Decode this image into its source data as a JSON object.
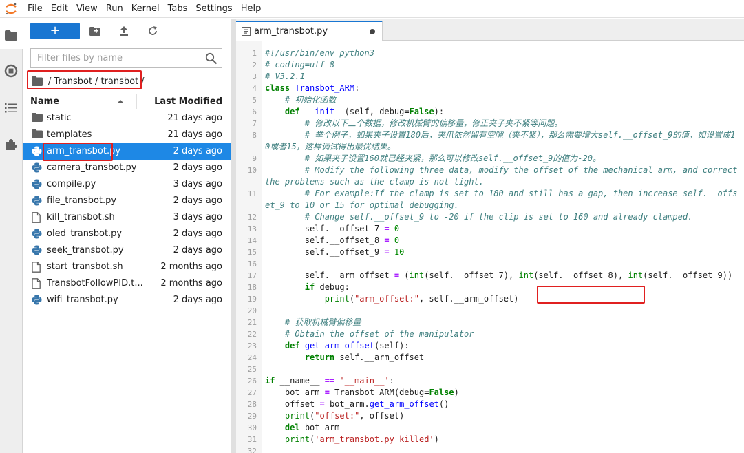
{
  "menubar": {
    "items": [
      "File",
      "Edit",
      "View",
      "Run",
      "Kernel",
      "Tabs",
      "Settings",
      "Help"
    ]
  },
  "toolbar": {
    "new_label": "+"
  },
  "filter": {
    "placeholder": "Filter files by name"
  },
  "breadcrumbs": {
    "root": "/",
    "parts": [
      "Transbot",
      "transbot"
    ],
    "trailing": "/"
  },
  "listing": {
    "header_name": "Name",
    "header_modified": "Last Modified",
    "files": [
      {
        "name": "static",
        "modified": "21 days ago",
        "icon": "folder-icon"
      },
      {
        "name": "templates",
        "modified": "21 days ago",
        "icon": "folder-icon"
      },
      {
        "name": "arm_transbot.py",
        "modified": "2 days ago",
        "icon": "python-icon",
        "selected": true
      },
      {
        "name": "camera_transbot.py",
        "modified": "2 days ago",
        "icon": "python-icon"
      },
      {
        "name": "compile.py",
        "modified": "3 days ago",
        "icon": "python-icon"
      },
      {
        "name": "file_transbot.py",
        "modified": "2 days ago",
        "icon": "python-icon"
      },
      {
        "name": "kill_transbot.sh",
        "modified": "3 days ago",
        "icon": "file-icon"
      },
      {
        "name": "oled_transbot.py",
        "modified": "2 days ago",
        "icon": "python-icon"
      },
      {
        "name": "seek_transbot.py",
        "modified": "2 days ago",
        "icon": "python-icon"
      },
      {
        "name": "start_transbot.sh",
        "modified": "2 months ago",
        "icon": "file-icon"
      },
      {
        "name": "TransbotFollowPID.t...",
        "modified": "2 months ago",
        "icon": "file-icon"
      },
      {
        "name": "wifi_transbot.py",
        "modified": "2 days ago",
        "icon": "python-icon"
      }
    ]
  },
  "editor": {
    "tab_label": "arm_transbot.py",
    "lines": [
      {
        "n": "1",
        "html": "<span class=\"cmt\">#!/usr/bin/env python3</span>"
      },
      {
        "n": "2",
        "html": "<span class=\"cmt\"># coding=utf-8</span>"
      },
      {
        "n": "3",
        "html": "<span class=\"cmt\"># V3.2.1</span>"
      },
      {
        "n": "4",
        "html": "<span class=\"kw\">class</span> <span class=\"cls\">Transbot_ARM</span>:"
      },
      {
        "n": "5",
        "html": "    <span class=\"cmt\"># 初始化函数</span>"
      },
      {
        "n": "6",
        "html": "    <span class=\"kw\">def</span> <span class=\"fn\">__init__</span>(self, debug=<span class=\"kw\">False</span>):"
      },
      {
        "n": "7",
        "html": "        <span class=\"cmt\"># 修改以下三个数据，修改机械臂的偏移量，修正夹子夹不紧等问题。</span>"
      },
      {
        "n": "8",
        "html": "        <span class=\"cmt\"># 举个例子，如果夹子设置180后，夹爪依然留有空隙（夹不紧），那么需要增大self.__offset_9的值，如设置成10或者15，这样调试得出最优结果。</span>"
      },
      {
        "n": "9",
        "html": "        <span class=\"cmt\"># 如果夹子设置160就已经夹紧，那么可以修改self.__offset_9的值为-20。</span>"
      },
      {
        "n": "10",
        "html": "        <span class=\"cmt\"># Modify the following three data, modify the offset of the mechanical arm, and correct the problems such as the clamp is not tight.</span>"
      },
      {
        "n": "11",
        "html": "        <span class=\"cmt\"># For example:If the clamp is set to 180 and still has a gap, then increase self.__offset_9 to 10 or 15 for optimal debugging.</span>"
      },
      {
        "n": "12",
        "html": "        <span class=\"cmt\"># Change self.__offset_9 to -20 if the clip is set to 160 and already clamped.</span>"
      },
      {
        "n": "13",
        "html": "        self.__offset_7 <span class=\"op\">=</span> <span class=\"num\">0</span>"
      },
      {
        "n": "14",
        "html": "        self.__offset_8 <span class=\"op\">=</span> <span class=\"num\">0</span>"
      },
      {
        "n": "15",
        "html": "        self.__offset_9 <span class=\"op\">=</span> <span class=\"num\">10</span>"
      },
      {
        "n": "16",
        "html": ""
      },
      {
        "n": "17",
        "html": "        self.__arm_offset <span class=\"op\">=</span> (<span class=\"bi\">int</span>(self.__offset_7), <span class=\"bi\">int</span>(self.__offset_8), <span class=\"bi\">int</span>(self.__offset_9))"
      },
      {
        "n": "18",
        "html": "        <span class=\"kw\">if</span> debug:"
      },
      {
        "n": "19",
        "html": "            <span class=\"bi\">print</span>(<span class=\"str\">\"arm_offset:\"</span>, self.__arm_offset)"
      },
      {
        "n": "20",
        "html": ""
      },
      {
        "n": "21",
        "html": "    <span class=\"cmt\"># 获取机械臂偏移量</span>"
      },
      {
        "n": "22",
        "html": "    <span class=\"cmt\"># Obtain the offset of the manipulator</span>"
      },
      {
        "n": "23",
        "html": "    <span class=\"kw\">def</span> <span class=\"fn\">get_arm_offset</span>(self):"
      },
      {
        "n": "24",
        "html": "        <span class=\"kw\">return</span> self.__arm_offset"
      },
      {
        "n": "25",
        "html": ""
      },
      {
        "n": "26",
        "html": "<span class=\"kw\">if</span> __name__ <span class=\"op\">==</span> <span class=\"str\">'__main__'</span>:"
      },
      {
        "n": "27",
        "html": "    bot_arm <span class=\"op\">=</span> Transbot_ARM(debug=<span class=\"kw\">False</span>)"
      },
      {
        "n": "28",
        "html": "    offset <span class=\"op\">=</span> bot_arm.<span class=\"fn\">get_arm_offset</span>()"
      },
      {
        "n": "29",
        "html": "    <span class=\"bi\">print</span>(<span class=\"str\">\"offset:\"</span>, offset)"
      },
      {
        "n": "30",
        "html": "    <span class=\"kw\">del</span> bot_arm"
      },
      {
        "n": "31",
        "html": "    <span class=\"bi\">print</span>(<span class=\"str\">'arm_transbot.py killed'</span>)"
      },
      {
        "n": "32",
        "html": ""
      }
    ]
  },
  "colors": {
    "accent": "#1976d2",
    "selection": "#1e88e5",
    "annotation": "#e02020"
  }
}
